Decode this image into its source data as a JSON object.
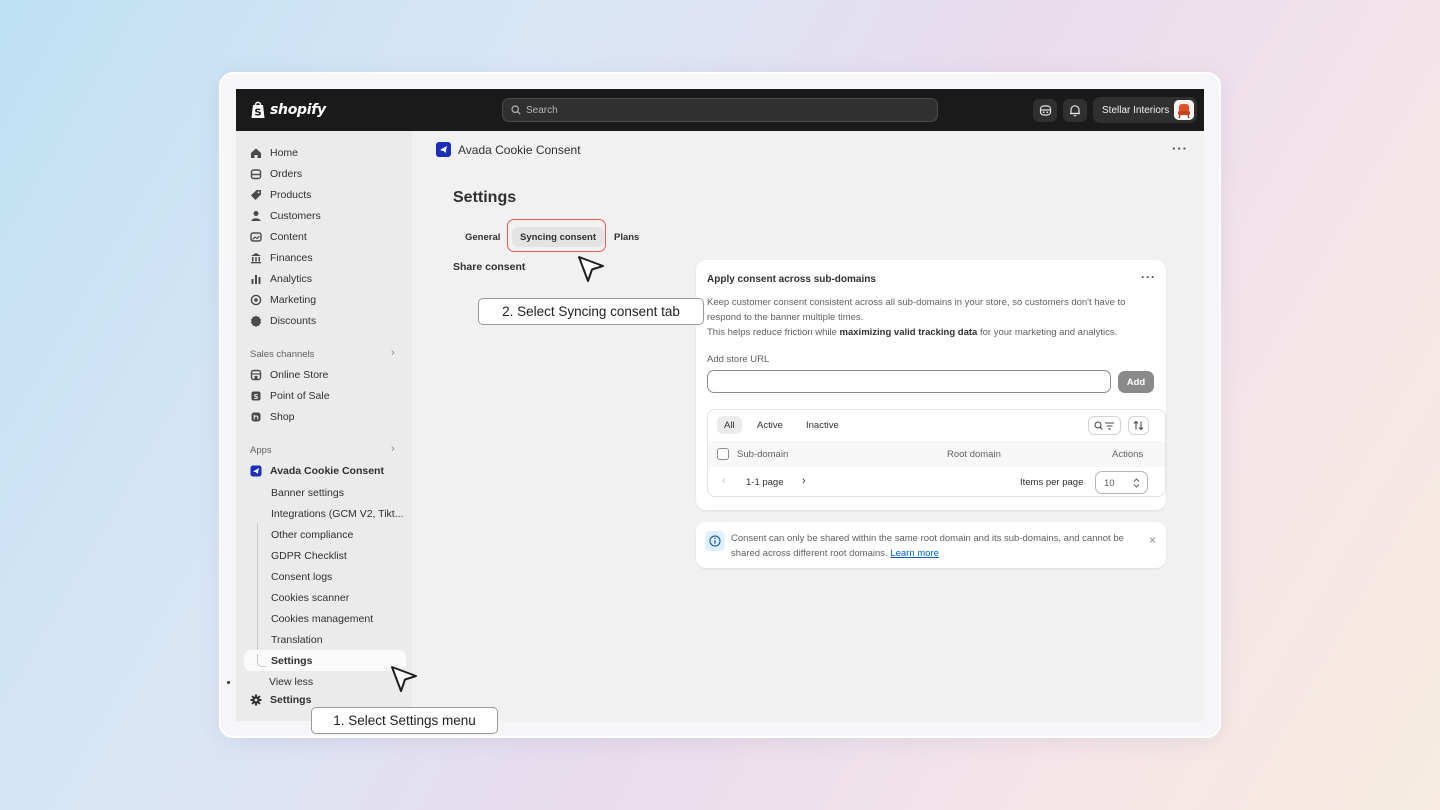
{
  "topbar": {
    "brand": "shopify",
    "search_placeholder": "Search",
    "store_name": "Stellar Interiors"
  },
  "sidebar": {
    "nav": [
      {
        "label": "Home",
        "icon": "home-icon"
      },
      {
        "label": "Orders",
        "icon": "orders-icon"
      },
      {
        "label": "Products",
        "icon": "tag-icon"
      },
      {
        "label": "Customers",
        "icon": "person-icon"
      },
      {
        "label": "Content",
        "icon": "content-icon"
      },
      {
        "label": "Finances",
        "icon": "bank-icon"
      },
      {
        "label": "Analytics",
        "icon": "bar-chart-icon"
      },
      {
        "label": "Marketing",
        "icon": "target-icon"
      },
      {
        "label": "Discounts",
        "icon": "discount-icon"
      }
    ],
    "sales_channels": {
      "heading": "Sales channels",
      "items": [
        {
          "label": "Online Store",
          "icon": "store-icon"
        },
        {
          "label": "Point of Sale",
          "icon": "pos-icon"
        },
        {
          "label": "Shop",
          "icon": "shop-icon"
        }
      ]
    },
    "apps": {
      "heading": "Apps",
      "app_name": "Avada Cookie Consent",
      "subitems": [
        "Banner settings",
        "Integrations (GCM V2, Tikt...",
        "Other compliance",
        "GDPR Checklist",
        "Consent logs",
        "Cookies scanner",
        "Cookies management",
        "Translation",
        "Settings"
      ],
      "view_less": "View less"
    },
    "settings_label": "Settings"
  },
  "main": {
    "app_title": "Avada Cookie Consent",
    "page_title": "Settings",
    "tabs": [
      "General",
      "Syncing consent",
      "Plans"
    ],
    "active_tab": "Syncing consent",
    "section_title": "Share consent",
    "card": {
      "title": "Apply consent across sub-domains",
      "desc_1": "Keep customer consent consistent across all sub-domains in your store, so customers don't have to respond to the banner multiple times.",
      "desc_2_pre": "This helps reduce friction while ",
      "desc_2_bold": "maximizing valid tracking data",
      "desc_2_post": " for your marketing and analytics.",
      "url_label": "Add store URL",
      "add_button": "Add",
      "filter_tabs": [
        "All",
        "Active",
        "Inactive"
      ],
      "columns": [
        "Sub-domain",
        "Root domain",
        "Actions"
      ],
      "page_label": "1-1 page",
      "items_per_page_label": "Items per page",
      "items_per_page_value": "10"
    },
    "banner": {
      "text": "Consent can only be shared within the same root domain and its sub-domains, and cannot be shared across different root domains.",
      "link": "Learn more"
    }
  },
  "callouts": {
    "step1": "1. Select Settings menu",
    "step2": "2. Select Syncing consent tab"
  },
  "colors": {
    "topbar": "#1a1a1a",
    "sidebar": "#ebebeb",
    "highlight": "#f05a5a",
    "app_icon": "#1a2eb8",
    "link": "#005bd3"
  }
}
